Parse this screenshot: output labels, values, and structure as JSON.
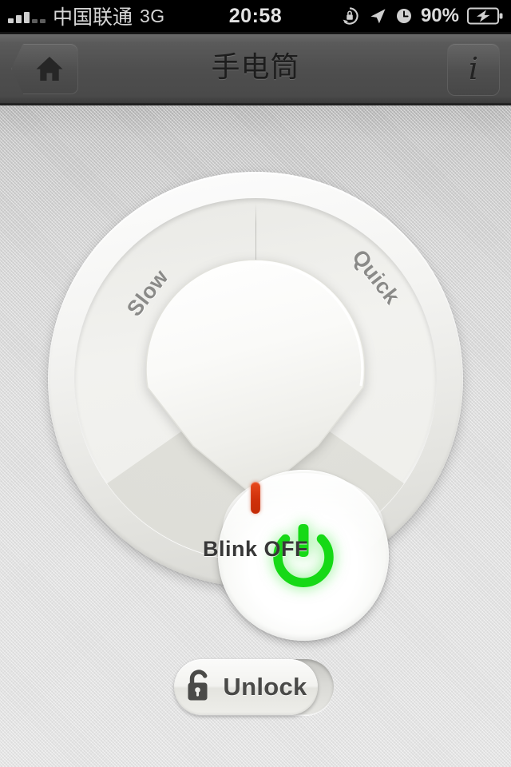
{
  "status_bar": {
    "carrier": "中国联通",
    "network": "3G",
    "time": "20:58",
    "battery_percent": "90%",
    "icons": [
      "signal-bars-icon",
      "rotation-lock-icon",
      "location-arrow-icon",
      "alarm-clock-icon",
      "battery-charging-icon"
    ]
  },
  "nav_bar": {
    "title": "手电筒",
    "home_button": "home-icon",
    "info_button": "i"
  },
  "dial": {
    "label_slow": "Slow",
    "label_quick": "Quick",
    "power_state_color": "#16d916",
    "indicator_color": "#d1320a",
    "blink_status": "Blink OFF"
  },
  "unlock": {
    "label": "Unlock",
    "icon": "unlocked-padlock-icon"
  },
  "theme": {
    "accent_green": "#16d916",
    "indicator_red": "#d1320a",
    "navbar_gray": "#4e4e4e",
    "background_gray": "#e2e2e2"
  }
}
